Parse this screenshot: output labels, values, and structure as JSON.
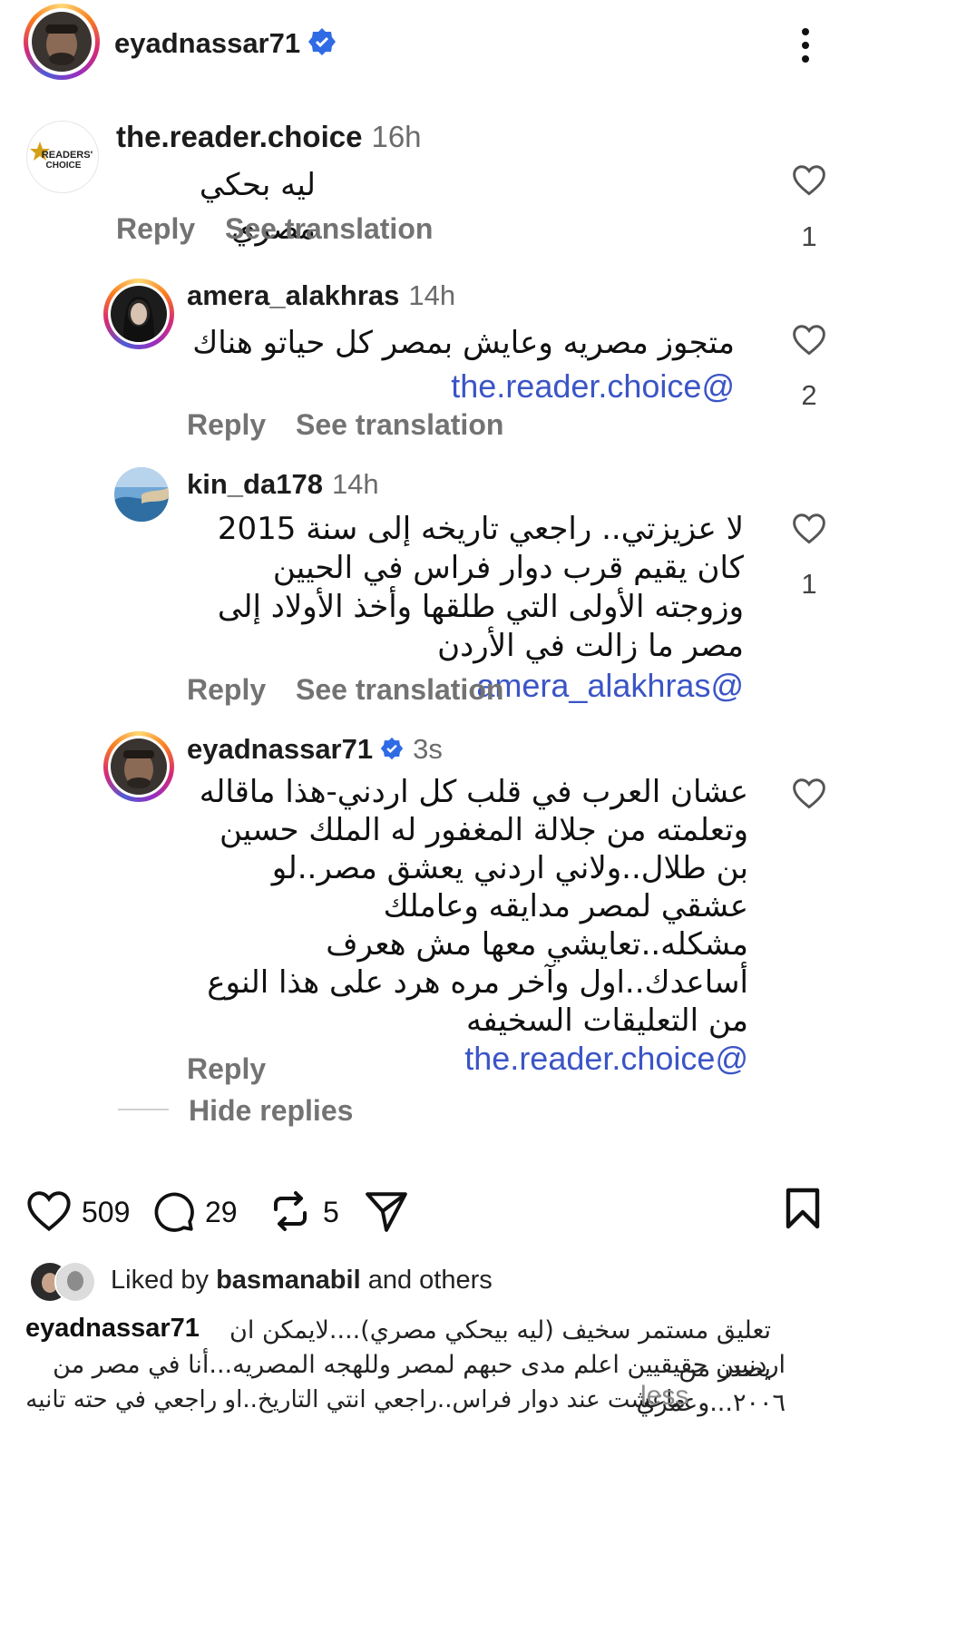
{
  "post_header": {
    "username": "eyadnassar71",
    "verified": true
  },
  "comments": [
    {
      "username": "the.reader.choice",
      "time": "16h",
      "avatar_text": "READERS' CHOICE",
      "text": "ليه بحكي مصري",
      "reply_label": "Reply",
      "translate_label": "See translation",
      "likes": "1"
    },
    {
      "username": "amera_alakhras",
      "time": "14h",
      "mention": "@the.reader.choice",
      "text": "متجوز مصريه وعايش بمصر كل حياتو هناك",
      "reply_label": "Reply",
      "translate_label": "See translation",
      "likes": "2"
    },
    {
      "username": "kin_da178",
      "time": "14h",
      "mention": "@amera_alakhras",
      "text": "لا عزيزتي.. راجعي تاريخه إلى سنة 2015 كان يقيم قرب دوار فراس في الحيين وزوجته الأولى التي طلقها وأخذ الأولاد إلى مصر ما زالت في الأردن",
      "reply_label": "Reply",
      "translate_label": "See translation",
      "likes": "1"
    },
    {
      "username": "eyadnassar71",
      "time": "3s",
      "mention": "@the.reader.choice",
      "text": "عشان العرب في قلب كل اردني-هذا ماقاله وتعلمته من جلالة المغفور له الملك حسين بن طلال..ولاني اردني يعشق مصر..لو عشقي لمصر مدايقه وعاملك مشكله..تعايشي معها مش هعرف أساعدك..اول وآخر مره هرد على هذا النوع من التعليقات السخيفه",
      "reply_label": "Reply"
    }
  ],
  "hide_replies_label": "Hide replies",
  "action_bar": {
    "likes": "509",
    "comments": "29",
    "reposts": "5"
  },
  "liked_by": {
    "prefix": "Liked by ",
    "user": "basmanabil",
    "suffix": " and others"
  },
  "caption": {
    "username": "eyadnassar71",
    "line1": "تعليق مستمر سخيف (ليه بيحكي مصري)....لايمكن ان يصدر من",
    "line2": "اردنيين حقيقيين اعلم مدى حبهم لمصر وللهجه المصريه...أنا في مصر من ٢٠٠٦...وعمري",
    "line3": "ماعشت عند دوار فراس..راجعي انتي التاريخ..او راجعي في حته تانيه",
    "less_label": "less"
  },
  "colors": {
    "mention": "#3b55c6",
    "verified": "#2f6be5",
    "muted": "#737373"
  }
}
